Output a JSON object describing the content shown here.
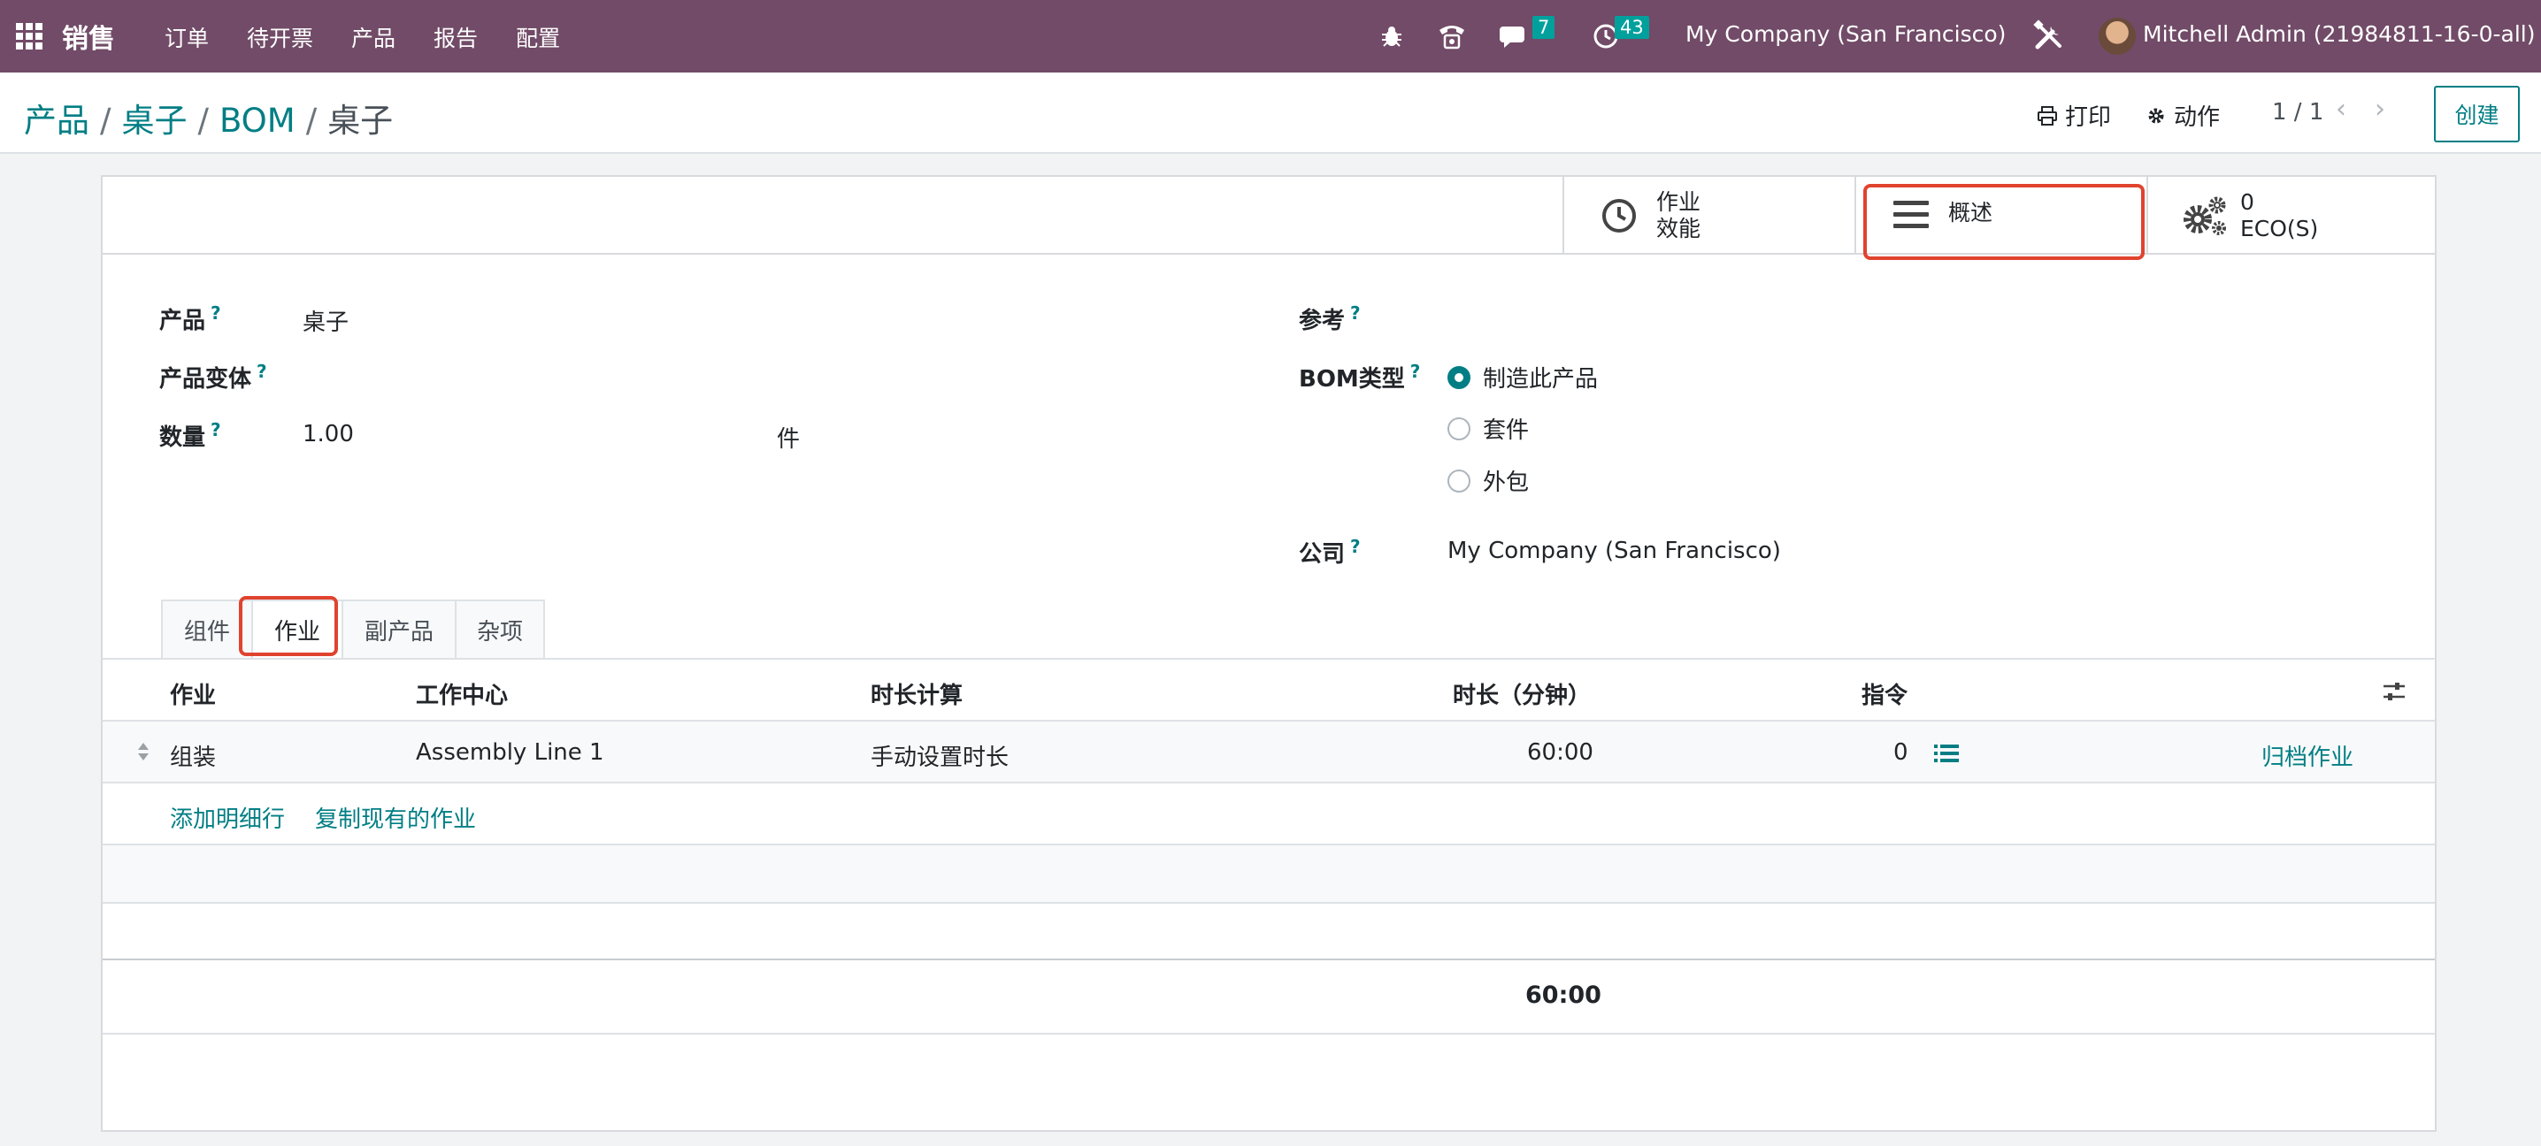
{
  "topnav": {
    "brand": "销售",
    "menu": [
      "订单",
      "待开票",
      "产品",
      "报告",
      "配置"
    ],
    "messages_count": "7",
    "activities_count": "43",
    "company": "My Company (San Francisco)",
    "user": "Mitchell Admin (21984811-16-0-all)"
  },
  "breadcrumb": {
    "items": [
      "产品",
      "桌子",
      "BOM"
    ],
    "current": "桌子"
  },
  "toolbar": {
    "print": "打印",
    "action": "动作",
    "pager": "1 / 1",
    "create": "创建"
  },
  "smart_buttons": {
    "efficiency_line1": "作业",
    "efficiency_line2": "效能",
    "overview": "概述",
    "eco_count": "0",
    "eco_label": "ECO(S)"
  },
  "form": {
    "product_label": "产品",
    "product_value": "桌子",
    "variant_label": "产品变体",
    "quantity_label": "数量",
    "quantity_value": "1.00",
    "uom_value": "件",
    "reference_label": "参考",
    "bom_type_label": "BOM类型",
    "bom_type_options": [
      "制造此产品",
      "套件",
      "外包"
    ],
    "bom_type_selected": "制造此产品",
    "company_label": "公司",
    "company_value": "My Company (San Francisco)"
  },
  "tabs": [
    "组件",
    "作业",
    "副产品",
    "杂项"
  ],
  "active_tab": "作业",
  "operations_table": {
    "columns": [
      "作业",
      "工作中心",
      "时长计算",
      "时长（分钟）",
      "指令"
    ],
    "rows": [
      {
        "operation": "组装",
        "workcenter": "Assembly Line 1",
        "duration_mode": "手动设置时长",
        "duration": "60:00",
        "instructions": "0",
        "archive": "归档作业"
      }
    ],
    "add_line": "添加明细行",
    "copy_existing": "复制现有的作业",
    "total_duration": "60:00"
  },
  "colors": {
    "brand_purple": "#714b67",
    "accent_teal": "#017e84",
    "highlight_red": "#e0432f"
  }
}
